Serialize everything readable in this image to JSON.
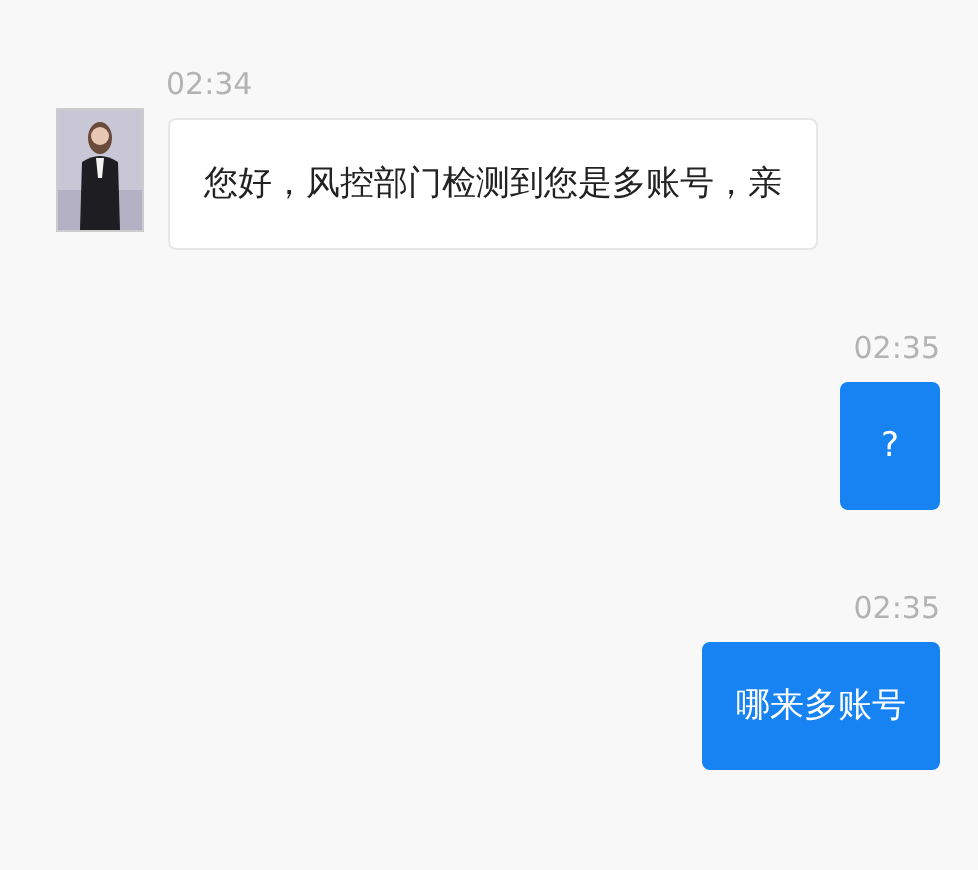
{
  "messages": [
    {
      "kind": "incoming",
      "time": "02:34",
      "text": "您好，风控部门检测到您是多账号，亲"
    },
    {
      "kind": "outgoing",
      "time": "02:35",
      "text": "?"
    },
    {
      "kind": "outgoing",
      "time": "02:35",
      "text": "哪来多账号"
    }
  ]
}
